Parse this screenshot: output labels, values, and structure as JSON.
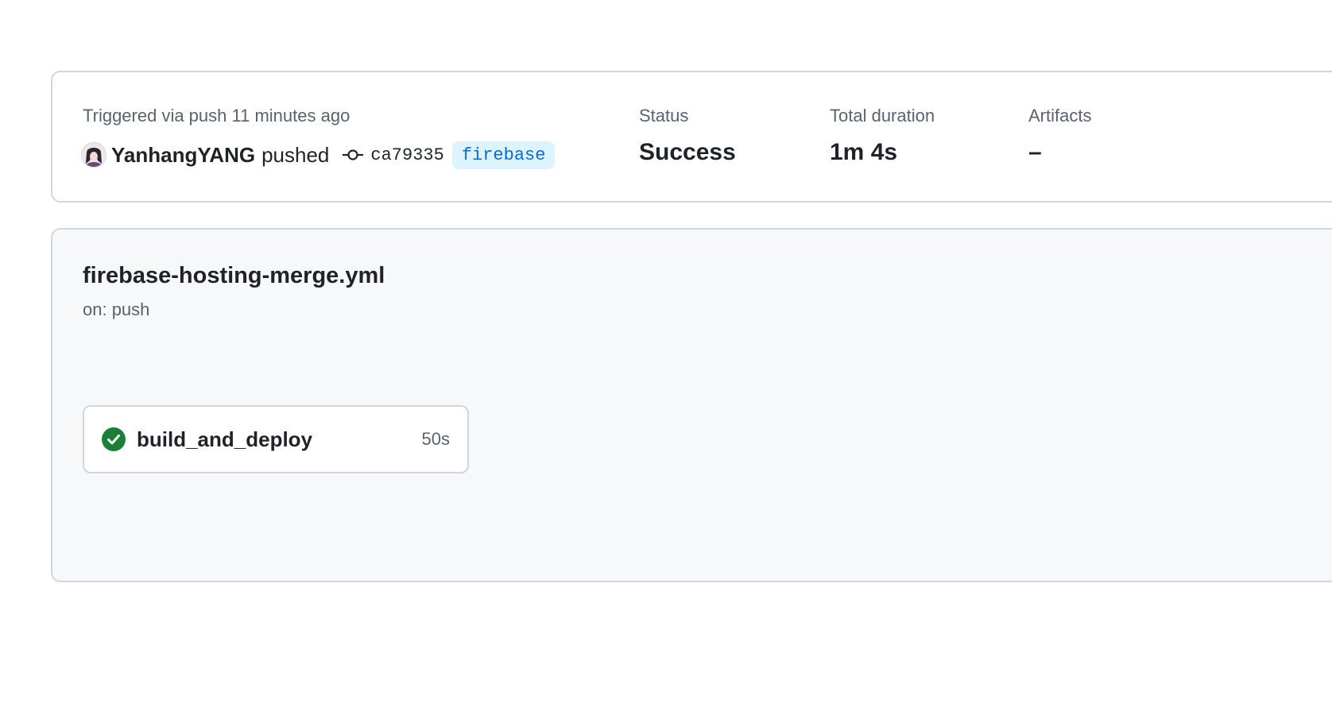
{
  "summary": {
    "trigger_label": "Triggered via push 11 minutes ago",
    "user_name": "YanhangYANG",
    "pushed_text": "pushed",
    "commit_sha": "ca79335",
    "branch": "firebase",
    "status": {
      "label": "Status",
      "value": "Success"
    },
    "duration": {
      "label": "Total duration",
      "value": "1m 4s"
    },
    "artifacts": {
      "label": "Artifacts",
      "value": "–"
    }
  },
  "workflow": {
    "title": "firebase-hosting-merge.yml",
    "trigger": "on: push",
    "jobs": [
      {
        "name": "build_and_deploy",
        "duration": "50s",
        "status_icon": "check-circle-icon",
        "status_color": "#1a7f37"
      }
    ]
  },
  "colors": {
    "border": "#d0d7de",
    "muted_text": "#59636e",
    "branch_bg": "#ddf4ff",
    "branch_text": "#0969da",
    "success": "#1a7f37",
    "workflow_bg": "#f6f8fa"
  }
}
